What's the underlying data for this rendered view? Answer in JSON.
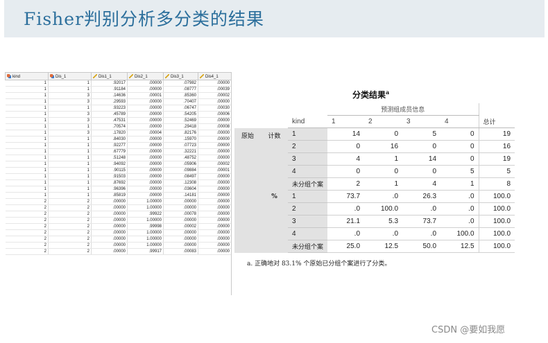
{
  "slide": {
    "title": "Fisher判别分析多分类的结果"
  },
  "grid": {
    "columns": [
      "kind",
      "Dis_1",
      "Dis1_1",
      "Dis2_1",
      "Dis3_1",
      "Dis4_1"
    ],
    "column_icons": [
      "nominal-measure-icon",
      "nominal-measure-icon",
      "scale-measure-icon",
      "scale-measure-icon",
      "scale-measure-icon",
      "scale-measure-icon"
    ],
    "rows": [
      [
        "1",
        "1",
        ".92017",
        ".00000",
        ".07982",
        ".00000"
      ],
      [
        "1",
        "1",
        ".91184",
        ".00000",
        ".08777",
        ".00039"
      ],
      [
        "1",
        "3",
        ".14636",
        ".00001",
        ".85360",
        ".00002"
      ],
      [
        "1",
        "3",
        ".29593",
        ".00000",
        ".70407",
        ".00000"
      ],
      [
        "1",
        "1",
        ".93223",
        ".00000",
        ".06747",
        ".00030"
      ],
      [
        "1",
        "3",
        ".45789",
        ".00000",
        ".54205",
        ".00006"
      ],
      [
        "1",
        "3",
        ".47531",
        ".00000",
        ".52469",
        ".00000"
      ],
      [
        "1",
        "1",
        ".70574",
        ".00000",
        ".29418",
        ".00008"
      ],
      [
        "1",
        "3",
        ".17820",
        ".00004",
        ".82176",
        ".00000"
      ],
      [
        "1",
        "1",
        ".84030",
        ".00000",
        ".15970",
        ".00000"
      ],
      [
        "1",
        "1",
        ".92277",
        ".00000",
        ".07723",
        ".00000"
      ],
      [
        "1",
        "1",
        ".67779",
        ".00000",
        ".32221",
        ".00000"
      ],
      [
        "1",
        "1",
        ".51248",
        ".00000",
        ".48752",
        ".00000"
      ],
      [
        "1",
        "1",
        ".94092",
        ".00000",
        ".05906",
        ".00002"
      ],
      [
        "1",
        "1",
        ".90115",
        ".00000",
        ".09884",
        ".00001"
      ],
      [
        "1",
        "1",
        ".91503",
        ".00000",
        ".08497",
        ".00000"
      ],
      [
        "1",
        "1",
        ".87692",
        ".00000",
        ".12308",
        ".00000"
      ],
      [
        "1",
        "1",
        ".96396",
        ".00000",
        ".03604",
        ".00000"
      ],
      [
        "1",
        "1",
        ".85819",
        ".00000",
        ".14181",
        ".00000"
      ],
      [
        "2",
        "2",
        ".00000",
        "1.00000",
        ".00000",
        ".00000"
      ],
      [
        "2",
        "2",
        ".00000",
        "1.00000",
        ".00000",
        ".00000"
      ],
      [
        "2",
        "2",
        ".00000",
        ".99922",
        ".00078",
        ".00000"
      ],
      [
        "2",
        "2",
        ".00000",
        "1.00000",
        ".00000",
        ".00000"
      ],
      [
        "2",
        "2",
        ".00000",
        ".99998",
        ".00002",
        ".00000"
      ],
      [
        "2",
        "2",
        ".00000",
        "1.00000",
        ".00000",
        ".00000"
      ],
      [
        "2",
        "2",
        ".00000",
        "1.00000",
        ".00000",
        ".00000"
      ],
      [
        "2",
        "2",
        ".00000",
        "1.00000",
        ".00000",
        ".00000"
      ],
      [
        "2",
        "2",
        ".00000",
        ".99917",
        ".00083",
        ".00000"
      ]
    ]
  },
  "classification": {
    "title": "分类结果",
    "title_sup": "a",
    "predicted_header": "预测组成员信息",
    "kind_header": "kind",
    "col_headers": [
      "1",
      "2",
      "3",
      "4"
    ],
    "total_header": "总计",
    "original_label": "原始",
    "count_label": "计数",
    "percent_label": "%",
    "count_rows": [
      {
        "label": "1",
        "values": [
          "14",
          "0",
          "5",
          "0"
        ],
        "total": "19"
      },
      {
        "label": "2",
        "values": [
          "0",
          "16",
          "0",
          "0"
        ],
        "total": "16"
      },
      {
        "label": "3",
        "values": [
          "4",
          "1",
          "14",
          "0"
        ],
        "total": "19"
      },
      {
        "label": "4",
        "values": [
          "0",
          "0",
          "0",
          "5"
        ],
        "total": "5"
      },
      {
        "label": "未分组个案",
        "values": [
          "2",
          "1",
          "4",
          "1"
        ],
        "total": "8"
      }
    ],
    "percent_rows": [
      {
        "label": "1",
        "values": [
          "73.7",
          ".0",
          "26.3",
          ".0"
        ],
        "total": "100.0"
      },
      {
        "label": "2",
        "values": [
          ".0",
          "100.0",
          ".0",
          ".0"
        ],
        "total": "100.0"
      },
      {
        "label": "3",
        "values": [
          "21.1",
          "5.3",
          "73.7",
          ".0"
        ],
        "total": "100.0"
      },
      {
        "label": "4",
        "values": [
          ".0",
          ".0",
          ".0",
          "100.0"
        ],
        "total": "100.0"
      },
      {
        "label": "未分组个案",
        "values": [
          "25.0",
          "12.5",
          "50.0",
          "12.5"
        ],
        "total": "100.0"
      }
    ],
    "footnote": "a. 正确地对 83.1% 个原始已分组个案进行了分类。"
  },
  "watermark": "CSDN @要如我愿"
}
